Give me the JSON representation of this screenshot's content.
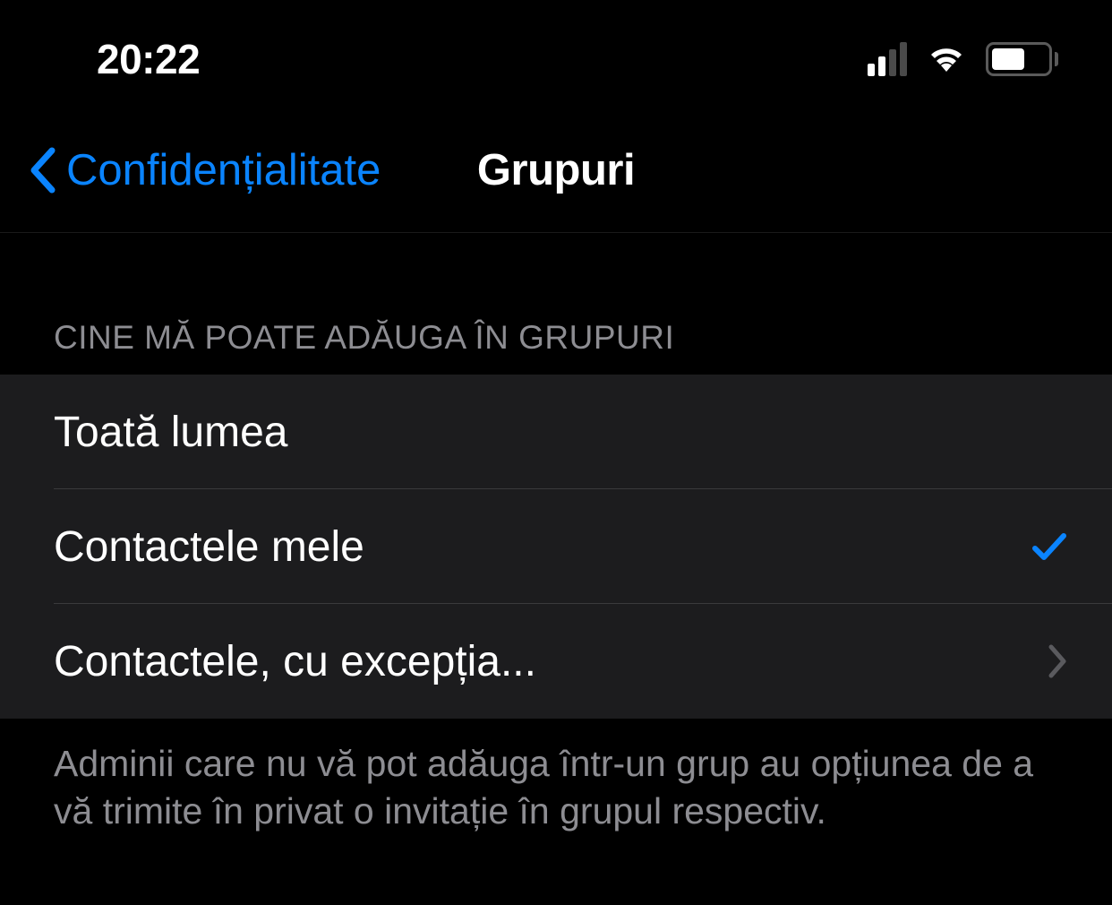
{
  "status": {
    "time": "20:22"
  },
  "nav": {
    "back_label": "Confidențialitate",
    "title": "Grupuri"
  },
  "section": {
    "header": "CINE MĂ POATE ADĂUGA ÎN GRUPURI",
    "options": [
      {
        "label": "Toată lumea",
        "selected": false,
        "disclosure": false
      },
      {
        "label": "Contactele mele",
        "selected": true,
        "disclosure": false
      },
      {
        "label": "Contactele, cu excepția...",
        "selected": false,
        "disclosure": true
      }
    ],
    "footer": "Adminii care nu vă pot adăuga într-un grup au opțiunea de a vă trimite în privat o invitație în grupul respectiv."
  },
  "colors": {
    "accent": "#0a84ff"
  }
}
